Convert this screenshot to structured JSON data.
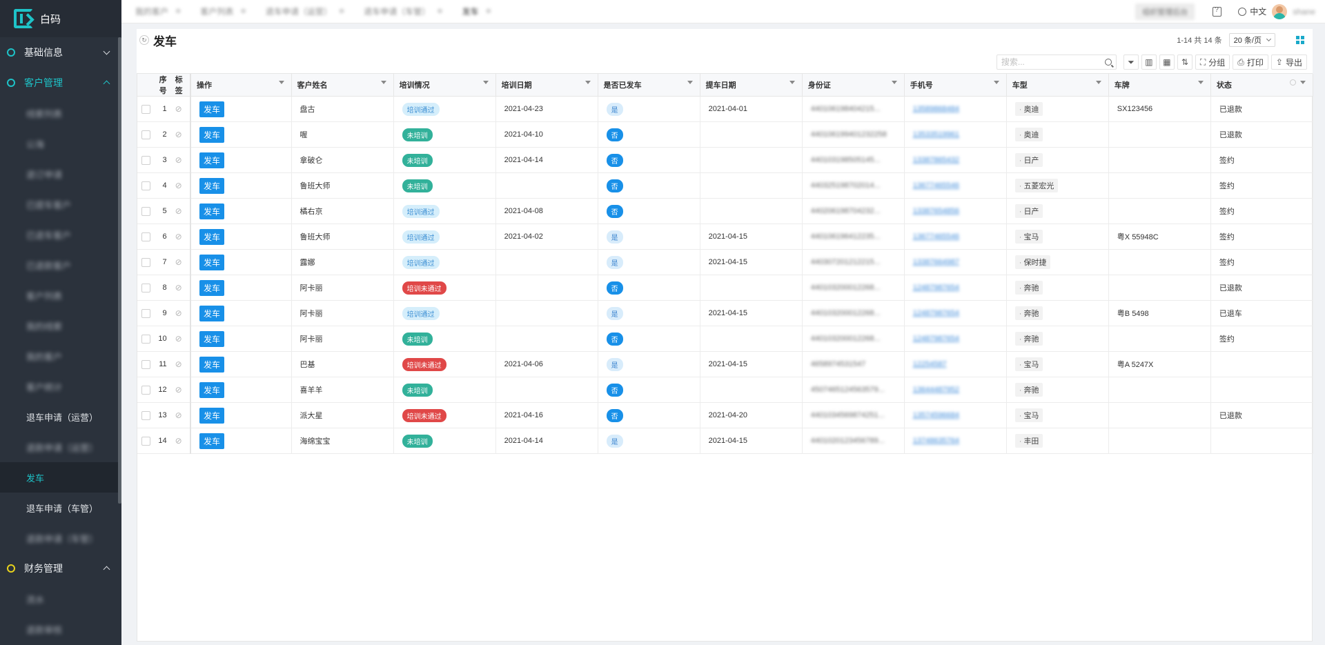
{
  "brand": {
    "name": "白码"
  },
  "sidebar": {
    "group_basic": "基础信息",
    "group_customer": "客户管理",
    "group_finance": "财务管理",
    "items": [
      {
        "label": "线索列表",
        "blur": true
      },
      {
        "label": "公海",
        "blur": true
      },
      {
        "label": "退订申请",
        "blur": true
      },
      {
        "label": "已提车客户",
        "blur": true
      },
      {
        "label": "已退车客户",
        "blur": true
      },
      {
        "label": "已退款客户",
        "blur": true
      },
      {
        "label": "客户列表",
        "blur": true
      },
      {
        "label": "我的线索",
        "blur": true
      },
      {
        "label": "我的客户",
        "blur": true
      },
      {
        "label": "客户统计",
        "blur": true
      },
      {
        "label": "退车申请（运营）",
        "blur": false
      },
      {
        "label": "退款申请（运营）",
        "blur": true
      },
      {
        "label": "发车",
        "blur": false,
        "active": true
      },
      {
        "label": "退车申请（车管）",
        "blur": false
      },
      {
        "label": "退款申请（车管）",
        "blur": true
      }
    ],
    "finance_items": [
      {
        "label": "流水",
        "blur": true
      },
      {
        "label": "退款审核",
        "blur": true
      }
    ]
  },
  "topbar": {
    "tabs": [
      "我的客户",
      "客户列表",
      "退车申请（运营）",
      "退车申请（车管）",
      "发车"
    ],
    "manage_btn": "组织管理后台",
    "lang": "中文",
    "user": "shane"
  },
  "page": {
    "title": "发车",
    "pager": "1-14 共 14 条",
    "page_size": "20 条/页",
    "search_placeholder": "搜索...",
    "group_label": "分组",
    "print_label": "打印",
    "export_label": "导出"
  },
  "table": {
    "headers": {
      "idx": "序号",
      "tag": "标签",
      "op": "操作",
      "name": "客户姓名",
      "train": "培训情况",
      "train_date": "培训日期",
      "sent": "是否已发车",
      "pickup": "提车日期",
      "id": "身份证",
      "phone": "手机号",
      "model": "车型",
      "plate": "车牌",
      "status": "状态"
    },
    "op_label": "发车",
    "rows": [
      {
        "idx": "1",
        "name": "盘古",
        "train": "培训通过",
        "train_date": "2021-04-23",
        "sent": "是",
        "pickup": "2021-04-01",
        "id": "440106198404215...",
        "phone": "13589868484",
        "model": "奥迪",
        "plate": "SX123456",
        "status": "已退款"
      },
      {
        "idx": "2",
        "name": "喔",
        "train": "未培训",
        "train_date": "2021-04-10",
        "sent": "否",
        "pickup": "",
        "id": "440106199401232258",
        "phone": "13533519961",
        "model": "奥迪",
        "plate": "",
        "status": "已退款"
      },
      {
        "idx": "3",
        "name": "拿破仑",
        "train": "未培训",
        "train_date": "2021-04-14",
        "sent": "否",
        "pickup": "",
        "id": "440103198505145...",
        "phone": "13387865432",
        "model": "日产",
        "plate": "",
        "status": "签约"
      },
      {
        "idx": "4",
        "name": "鲁班大师",
        "train": "未培训",
        "train_date": "",
        "sent": "否",
        "pickup": "",
        "id": "440325198702014...",
        "phone": "13677465546",
        "model": "五菱宏光",
        "plate": "",
        "status": "签约"
      },
      {
        "idx": "5",
        "name": "橘右京",
        "train": "培训通过",
        "train_date": "2021-04-08",
        "sent": "否",
        "pickup": "",
        "id": "440206198704232...",
        "phone": "13387654856",
        "model": "日产",
        "plate": "",
        "status": "签约"
      },
      {
        "idx": "6",
        "name": "鲁班大师",
        "train": "培训通过",
        "train_date": "2021-04-02",
        "sent": "是",
        "pickup": "2021-04-15",
        "id": "440106196412235...",
        "phone": "13677465546",
        "model": "宝马",
        "plate": "粤X 55948C",
        "status": "签约"
      },
      {
        "idx": "7",
        "name": "露娜",
        "train": "培训通过",
        "train_date": "",
        "sent": "是",
        "pickup": "2021-04-15",
        "id": "440307201212215...",
        "phone": "13387664987",
        "model": "保时捷",
        "plate": "",
        "status": "签约"
      },
      {
        "idx": "8",
        "name": "阿卡丽",
        "train": "培训未通过",
        "train_date": "",
        "sent": "否",
        "pickup": "",
        "id": "440103200012268...",
        "phone": "12487987654",
        "model": "奔驰",
        "plate": "",
        "status": "已退款"
      },
      {
        "idx": "9",
        "name": "阿卡丽",
        "train": "培训通过",
        "train_date": "",
        "sent": "是",
        "pickup": "2021-04-15",
        "id": "440103200012268...",
        "phone": "12487987654",
        "model": "奔驰",
        "plate": "粤B 5498",
        "status": "已退车"
      },
      {
        "idx": "10",
        "name": "阿卡丽",
        "train": "未培训",
        "train_date": "",
        "sent": "否",
        "pickup": "",
        "id": "440103200012268...",
        "phone": "12487987654",
        "model": "奔驰",
        "plate": "",
        "status": "签约"
      },
      {
        "idx": "11",
        "name": "巴基",
        "train": "培训未通过",
        "train_date": "2021-04-06",
        "sent": "是",
        "pickup": "2021-04-15",
        "id": "465897453154​7",
        "phone": "12254587",
        "model": "宝马",
        "plate": "粤A 5247X",
        "status": ""
      },
      {
        "idx": "12",
        "name": "喜羊羊",
        "train": "未培训",
        "train_date": "",
        "sent": "否",
        "pickup": "",
        "id": "450746512456357​9...",
        "phone": "13644487952",
        "model": "奔驰",
        "plate": "",
        "status": ""
      },
      {
        "idx": "13",
        "name": "派大星",
        "train": "培训未通过",
        "train_date": "2021-04-16",
        "sent": "否",
        "pickup": "2021-04-20",
        "id": "440103456987​4251...",
        "phone": "13574596684",
        "model": "宝马",
        "plate": "",
        "status": "已退款"
      },
      {
        "idx": "14",
        "name": "海绵宝宝",
        "train": "未培训",
        "train_date": "2021-04-14",
        "sent": "是",
        "pickup": "2021-04-15",
        "id": "440102012345​6789...",
        "phone": "13748635764",
        "model": "丰田",
        "plate": "",
        "status": ""
      }
    ]
  },
  "colors": {
    "accent": "#1ec3c8",
    "primary": "#1890e8",
    "sidebar_bg": "#2b323c"
  }
}
